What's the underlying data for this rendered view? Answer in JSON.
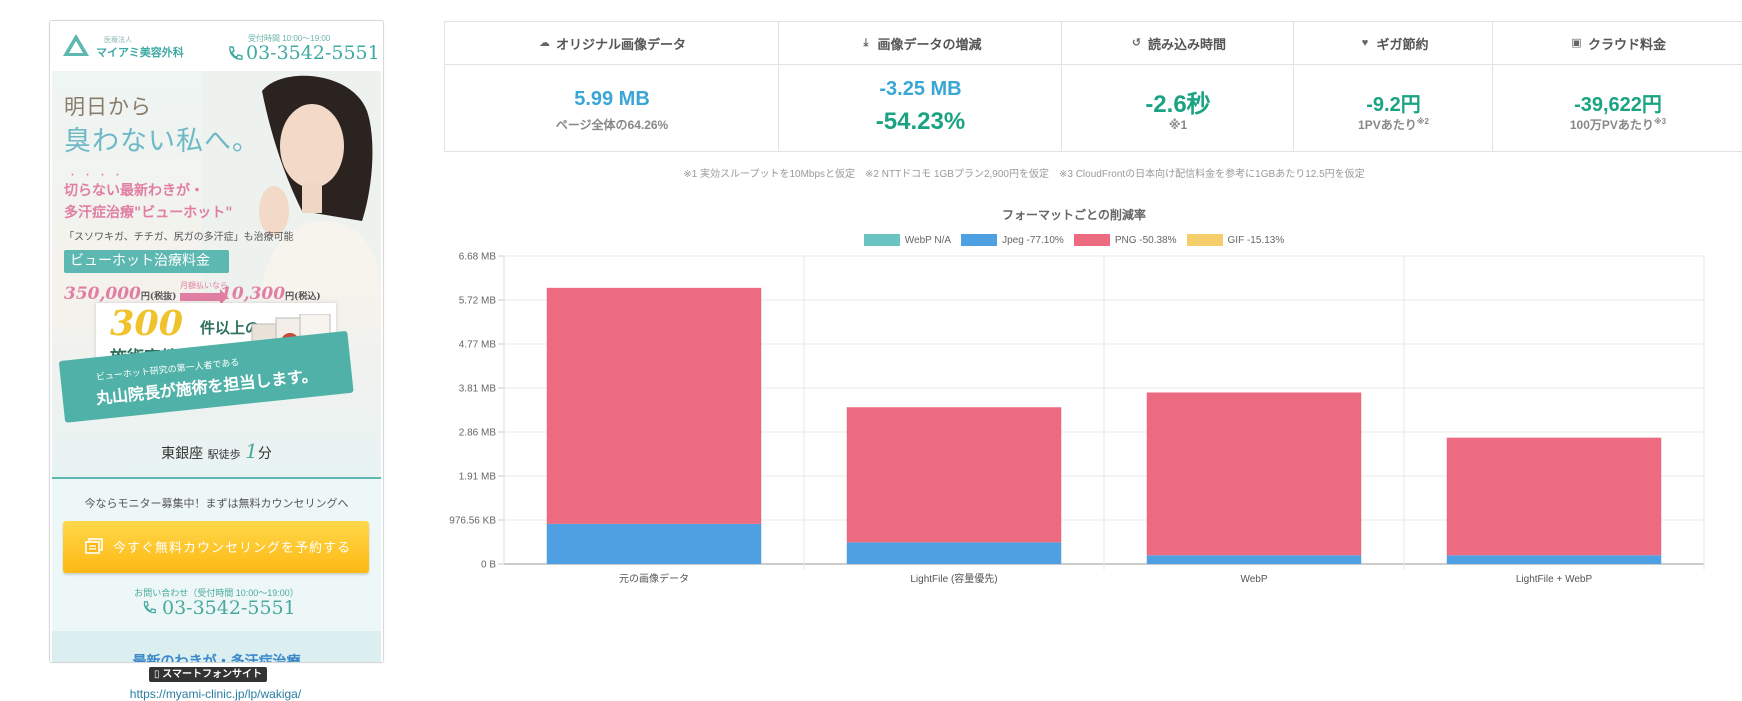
{
  "phone_preview": {
    "logo_small": "医療法人",
    "logo": "マイアミ美容外科",
    "hours": "受付時間 10:00〜19:00",
    "phone": "03-3542-5551",
    "headline_1": "明日から",
    "headline_2": "臭わない私へ。",
    "dots": "・・・・",
    "pink_line_1": "切らない最新わきが・",
    "pink_line_2": "多汗症治療\"ビューホット\"",
    "note": "「スソワキガ、チチガ、尻ガの多汗症」も治療可能",
    "band_label": "ビューホット治療料金",
    "price_old": "350,000",
    "price_old_suffix": "円(税抜)",
    "arrow_label": "月額払いなら",
    "price_new": "10,300",
    "price_new_suffix": "円(税込)",
    "cases_number": "300",
    "cases_label": "件以上の",
    "cases_title": "施術実績",
    "ribbon_small": "ビューホット研究の第一人者である",
    "ribbon_large": "丸山院長が施術を担当します。",
    "station": "東銀座",
    "station_small": "駅徒歩",
    "station_num": "1",
    "station_unit": "分",
    "monitor_text": "今ならモニター募集中！まずは無料カウンセリングへ",
    "cta_label": "今すぐ無料カウンセリングを予約する",
    "contact_label": "お問い合わせ（受付時間 10:00〜19:00）",
    "contact_phone": "03-3542-5551",
    "bottom_text": "最新のわきが・多汗症治療",
    "badge": "スマートフォンサイト",
    "url": "https://myami-clinic.jp/lp/wakiga/"
  },
  "stats": {
    "headers": [
      {
        "icon": "cloud-upload-icon",
        "label": "オリジナル画像データ"
      },
      {
        "icon": "download-icon",
        "label": "画像データの増減"
      },
      {
        "icon": "history-icon",
        "label": "読み込み時間"
      },
      {
        "icon": "heart-icon",
        "label": "ギガ節約"
      },
      {
        "icon": "money-icon",
        "label": "クラウド料金"
      }
    ],
    "original_value": "5.99 MB",
    "original_sub": "ページ全体の64.26%",
    "delta_value": "-3.25 MB",
    "delta_percent": "-54.23%",
    "load_value": "-2.6秒",
    "load_sub": "※1",
    "giga_value": "-9.2円",
    "giga_sub": "1PVあたり",
    "giga_sup": "※2",
    "cloud_value": "-39,622円",
    "cloud_sub": "100万PVあたり",
    "cloud_sup": "※3"
  },
  "footnote": "※1 実効スループットを10Mbpsと仮定　※2 NTTドコモ 1GBプラン2,900円を仮定　※3 CloudFrontの日本向け配信料金を参考に1GBあたり12.5円を仮定",
  "colors": {
    "webp": "#6cc4c0",
    "jpeg": "#4f9fe3",
    "png": "#ec6b81",
    "gif": "#f6cd6b",
    "blue_text": "#39a6d6",
    "green_text": "#1aa383"
  },
  "chart_data": {
    "type": "bar",
    "stacked": true,
    "title": "フォーマットごとの削減率",
    "categories": [
      "元の画像データ",
      "LightFile (容量優先)",
      "WebP",
      "LightFile + WebP"
    ],
    "series": [
      {
        "name": "WebP N/A",
        "color": "#6cc4c0",
        "values_mb": [
          0,
          0,
          0,
          0
        ]
      },
      {
        "name": "Jpeg -77.10%",
        "color": "#4f9fe3",
        "values_mb": [
          0.87,
          0.47,
          0.19,
          0.19
        ]
      },
      {
        "name": "PNG -50.38%",
        "color": "#ec6b81",
        "values_mb": [
          5.12,
          2.93,
          3.53,
          2.55
        ]
      },
      {
        "name": "GIF -15.13%",
        "color": "#f6cd6b",
        "values_mb": [
          0,
          0,
          0,
          0
        ]
      }
    ],
    "y_ticks": [
      "0 B",
      "976.56 KB",
      "1.91 MB",
      "2.86 MB",
      "3.81 MB",
      "4.77 MB",
      "5.72 MB",
      "6.68 MB"
    ],
    "ylim_mb": [
      0,
      6.68
    ],
    "grid": true,
    "legend": "top-center"
  }
}
